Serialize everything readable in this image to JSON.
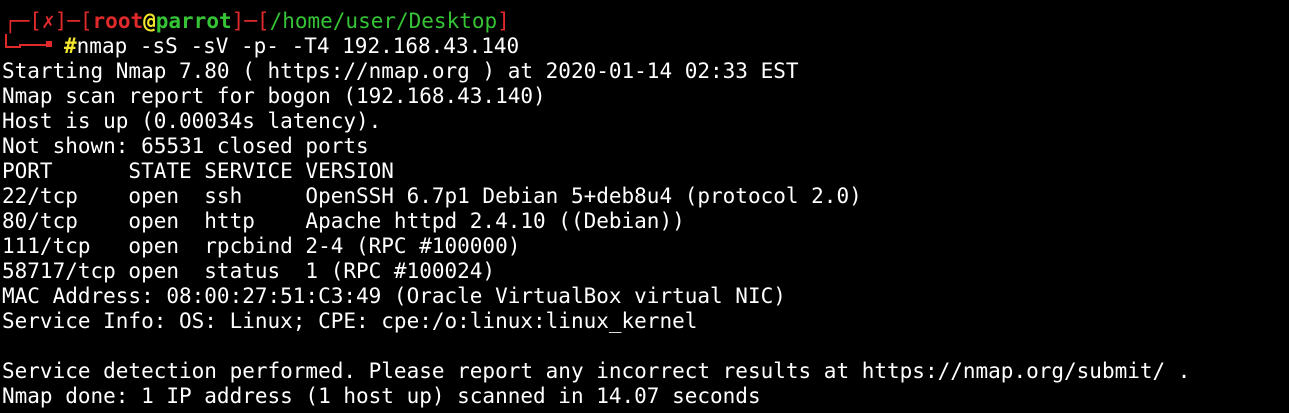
{
  "prompt": {
    "open_bracket1": "┌─[",
    "status": "✗",
    "mid": "]─[",
    "user": "root",
    "at": "@",
    "host": "parrot",
    "close_open": "]─[",
    "path": "/home/user/Desktop",
    "close_bracket": "]",
    "hash": "#",
    "command": "nmap -sS -sV -p- -T4 192.168.43.140"
  },
  "output": {
    "l1": "Starting Nmap 7.80 ( https://nmap.org ) at 2020-01-14 02:33 EST",
    "l2": "Nmap scan report for bogon (192.168.43.140)",
    "l3": "Host is up (0.00034s latency).",
    "l4": "Not shown: 65531 closed ports",
    "header": "PORT      STATE SERVICE VERSION",
    "rows": [
      "22/tcp    open  ssh     OpenSSH 6.7p1 Debian 5+deb8u4 (protocol 2.0)",
      "80/tcp    open  http    Apache httpd 2.4.10 ((Debian))",
      "111/tcp   open  rpcbind 2-4 (RPC #100000)",
      "58717/tcp open  status  1 (RPC #100024)"
    ],
    "mac": "MAC Address: 08:00:27:51:C3:49 (Oracle VirtualBox virtual NIC)",
    "service_info": "Service Info: OS: Linux; CPE: cpe:/o:linux:linux_kernel",
    "detection": "Service detection performed. Please report any incorrect results at https://nmap.org/submit/ .",
    "done": "Nmap done: 1 IP address (1 host up) scanned in 14.07 seconds"
  },
  "colors": {
    "background": "#000000",
    "text": "#ffffff",
    "prompt_red": "#e0292b",
    "path_green": "#35c435",
    "hash_yellow": "#f3e62e"
  }
}
